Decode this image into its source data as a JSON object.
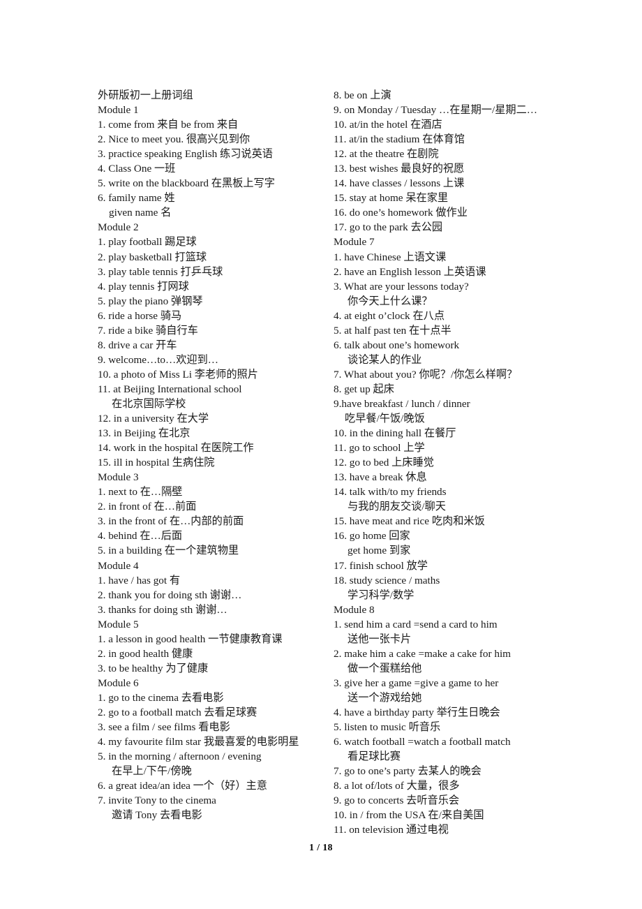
{
  "document": {
    "title": "外研版初一上册词组",
    "page_label": "1 / 18"
  },
  "left_column": [
    {
      "text": "外研版初一上册词组",
      "style": "normal"
    },
    {
      "text": "Module 1",
      "style": "normal"
    },
    {
      "text": "1. come from 来自    be from  来自",
      "style": "normal"
    },
    {
      "text": "2. Nice to meet you. 很高兴见到你",
      "style": "normal"
    },
    {
      "text": "3. practice speaking English 练习说英语",
      "style": "normal"
    },
    {
      "text": "4. Class One  一班",
      "style": "normal"
    },
    {
      "text": "5. write on the blackboard 在黑板上写字",
      "style": "normal"
    },
    {
      "text": "6. family name 姓",
      "style": "normal"
    },
    {
      "text": "given name 名",
      "style": "indent"
    },
    {
      "text": "Module 2",
      "style": "normal"
    },
    {
      "text": "1. play football 踢足球",
      "style": "normal"
    },
    {
      "text": "2. play basketball 打篮球",
      "style": "normal"
    },
    {
      "text": "3. play table tennis 打乒乓球",
      "style": "normal"
    },
    {
      "text": "4. play tennis 打网球",
      "style": "normal"
    },
    {
      "text": "5. play the piano 弹钢琴",
      "style": "normal"
    },
    {
      "text": "6. ride a horse 骑马",
      "style": "normal"
    },
    {
      "text": "7. ride a bike 骑自行车",
      "style": "normal"
    },
    {
      "text": "8. drive a car 开车",
      "style": "normal"
    },
    {
      "text": "9. welcome…to…欢迎到…",
      "style": "normal"
    },
    {
      "text": "10. a photo of   Miss Li 李老师的照片",
      "style": "normal"
    },
    {
      "text": "11. at Beijing International school",
      "style": "normal"
    },
    {
      "text": "在北京国际学校",
      "style": "indent2"
    },
    {
      "text": "12. in a university    在大学",
      "style": "normal"
    },
    {
      "text": "13. in Beijing 在北京",
      "style": "normal"
    },
    {
      "text": "14. work in the hospital 在医院工作",
      "style": "normal"
    },
    {
      "text": "15. ill in hospital 生病住院",
      "style": "normal"
    },
    {
      "text": "Module 3",
      "style": "normal"
    },
    {
      "text": "1. next to 在…隔壁",
      "style": "normal"
    },
    {
      "text": "2. in front of 在…前面",
      "style": "normal"
    },
    {
      "text": "3. in the front of 在…内部的前面",
      "style": "normal"
    },
    {
      "text": "4. behind 在…后面",
      "style": "normal"
    },
    {
      "text": "5. in a building 在一个建筑物里",
      "style": "normal"
    },
    {
      "text": "Module 4",
      "style": "normal"
    },
    {
      "text": "1. have / has got 有",
      "style": "normal"
    },
    {
      "text": "2. thank you for doing sth    谢谢…",
      "style": "normal"
    },
    {
      "text": "3. thanks for doing sth   谢谢…",
      "style": "normal"
    },
    {
      "text": "Module 5",
      "style": "normal"
    },
    {
      "text": "1. a lesson in good health 一节健康教育课",
      "style": "normal"
    },
    {
      "text": "2. in good health 健康",
      "style": "normal"
    },
    {
      "text": "3. to be healthy 为了健康",
      "style": "normal"
    },
    {
      "text": "Module 6",
      "style": "normal"
    },
    {
      "text": "1. go to the cinema 去看电影",
      "style": "normal"
    },
    {
      "text": "2. go to a football match 去看足球赛",
      "style": "normal"
    },
    {
      "text": "3. see a film / see films 看电影",
      "style": "normal"
    },
    {
      "text": "4. my favourite film star 我最喜爱的电影明星",
      "style": "normal"
    },
    {
      "text": "5. in the morning / afternoon / evening",
      "style": "normal"
    },
    {
      "text": "在早上/下午/傍晚",
      "style": "indent2"
    },
    {
      "text": "6. a great idea/an idea 一个（好）主意",
      "style": "normal"
    },
    {
      "text": "7. invite Tony to the cinema",
      "style": "normal"
    },
    {
      "text": "邀请 Tony 去看电影",
      "style": "indent2"
    }
  ],
  "right_column": [
    {
      "text": "8. be on 上演",
      "style": "normal"
    },
    {
      "text": "9. on Monday / Tuesday …在星期一/星期二…",
      "style": "normal"
    },
    {
      "text": "10. at/in the hotel 在酒店",
      "style": "normal"
    },
    {
      "text": "11. at/in the stadium 在体育馆",
      "style": "normal"
    },
    {
      "text": "12. at the theatre 在剧院",
      "style": "normal"
    },
    {
      "text": "13. best wishes 最良好的祝愿",
      "style": "normal"
    },
    {
      "text": "14. have classes / lessons 上课",
      "style": "normal"
    },
    {
      "text": "15. stay at home 呆在家里",
      "style": "normal"
    },
    {
      "text": "16. do one’s homework 做作业",
      "style": "normal"
    },
    {
      "text": "17. go to the park 去公园",
      "style": "normal"
    },
    {
      "text": "Module 7",
      "style": "normal"
    },
    {
      "text": "1. have Chinese 上语文课",
      "style": "normal"
    },
    {
      "text": "2. have an English lesson 上英语课",
      "style": "normal"
    },
    {
      "text": "3. What are your lessons today?",
      "style": "normal"
    },
    {
      "text": "你今天上什么课？",
      "style": "indent2"
    },
    {
      "text": "4. at eight o’clock 在八点",
      "style": "normal"
    },
    {
      "text": "5. at half past ten 在十点半",
      "style": "normal"
    },
    {
      "text": "6. talk about one’s homework",
      "style": "normal"
    },
    {
      "text": "谈论某人的作业",
      "style": "indent2"
    },
    {
      "text": "7. What about you? 你呢？/你怎么样啊？",
      "style": "normal"
    },
    {
      "text": "8. get up 起床",
      "style": "normal"
    },
    {
      "text": "9.have breakfast / lunch / dinner",
      "style": "normal"
    },
    {
      "text": "吃早餐/午饭/晚饭",
      "style": "indent"
    },
    {
      "text": "10. in the dining hall 在餐厅",
      "style": "normal"
    },
    {
      "text": "11. go to school 上学",
      "style": "normal"
    },
    {
      "text": "12. go to bed 上床睡觉",
      "style": "normal"
    },
    {
      "text": "13. have a break 休息",
      "style": "normal"
    },
    {
      "text": "14. talk with/to my friends",
      "style": "normal"
    },
    {
      "text": "与我的朋友交谈/聊天",
      "style": "indent2"
    },
    {
      "text": "15. have meat and rice 吃肉和米饭",
      "style": "normal"
    },
    {
      "text": "16. go home 回家",
      "style": "normal"
    },
    {
      "text": "get home 到家",
      "style": "indent2"
    },
    {
      "text": "17. finish school 放学",
      "style": "normal"
    },
    {
      "text": "18. study science / maths",
      "style": "normal"
    },
    {
      "text": "学习科学/数学",
      "style": "indent2"
    },
    {
      "text": "Module 8",
      "style": "normal"
    },
    {
      "text": "1. send him a card =send a card to him",
      "style": "normal"
    },
    {
      "text": "送他一张卡片",
      "style": "indent2"
    },
    {
      "text": "2. make him a cake =make a cake for him",
      "style": "normal"
    },
    {
      "text": "做一个蛋糕给他",
      "style": "indent2"
    },
    {
      "text": "3. give her a game =give a game to her",
      "style": "normal"
    },
    {
      "text": "送一个游戏给她",
      "style": "indent2"
    },
    {
      "text": "4. have a birthday party 举行生日晚会",
      "style": "normal"
    },
    {
      "text": "5. listen to music 听音乐",
      "style": "normal"
    },
    {
      "text": "6. watch football =watch a football match",
      "style": "normal"
    },
    {
      "text": "看足球比赛",
      "style": "indent2"
    },
    {
      "text": "7. go to one’s party 去某人的晚会",
      "style": "normal"
    },
    {
      "text": "8. a lot of/lots of 大量，很多",
      "style": "normal"
    },
    {
      "text": "9. go to concerts 去听音乐会",
      "style": "normal"
    },
    {
      "text": "10. in / from the USA 在/来自美国",
      "style": "normal"
    },
    {
      "text": "11. on television 通过电视",
      "style": "normal"
    }
  ]
}
